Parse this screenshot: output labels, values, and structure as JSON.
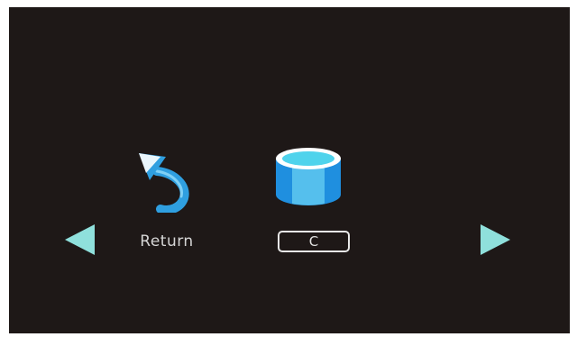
{
  "menu": {
    "return_label": "Return",
    "drive_label": "C"
  },
  "icons": {
    "left": "triangle-left-icon",
    "right": "triangle-right-icon",
    "return": "return-arrow-icon",
    "drive": "drive-cylinder-icon"
  },
  "colors": {
    "background": "#1e1817",
    "arrow": "#8fe0dc",
    "accent_blue": "#2f9fe0",
    "cylinder_top": "#4fd3ec",
    "text": "#d6d6d6"
  }
}
